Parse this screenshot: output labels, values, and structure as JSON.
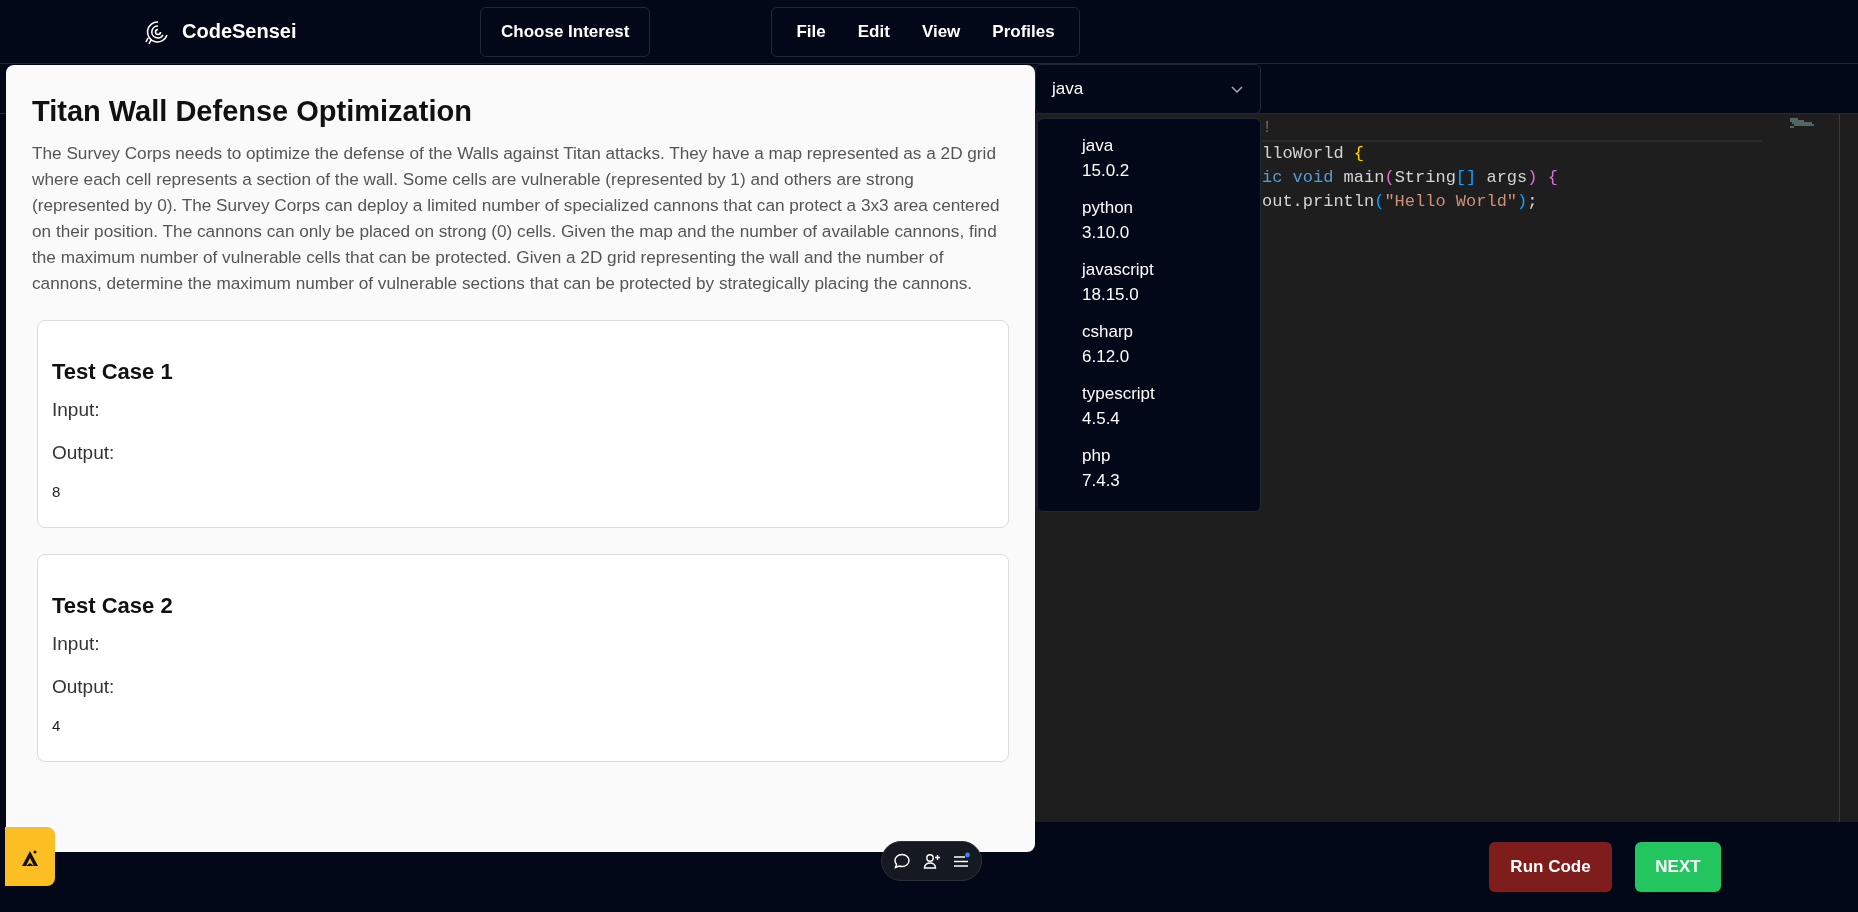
{
  "header": {
    "brand": "CodeSensei",
    "interest_button": "Choose Interest",
    "menu": [
      "File",
      "Edit",
      "View",
      "Profiles"
    ]
  },
  "problem": {
    "title": "Titan Wall Defense Optimization",
    "description": "The Survey Corps needs to optimize the defense of the Walls against Titan attacks. They have a map represented as a 2D grid where each cell represents a section of the wall. Some cells are vulnerable (represented by 1) and others are strong (represented by 0). The Survey Corps can deploy a limited number of specialized cannons that can protect a 3x3 area centered on their position. The cannons can only be placed on strong (0) cells. Given the map and the number of available cannons, find the maximum number of vulnerable cells that can be protected. Given a 2D grid representing the wall and the number of cannons, determine the maximum number of vulnerable sections that can be protected by strategically placing the cannons.",
    "test_cases": [
      {
        "title": "Test Case 1",
        "input_label": "Input:",
        "output_label": "Output:",
        "output": "8"
      },
      {
        "title": "Test Case 2",
        "input_label": "Input:",
        "output_label": "Output:",
        "output": "4"
      }
    ]
  },
  "editor": {
    "language_select": "java",
    "language_menu": [
      {
        "name": "java",
        "version": "15.0.2"
      },
      {
        "name": "python",
        "version": "3.10.0"
      },
      {
        "name": "javascript",
        "version": "18.15.0"
      },
      {
        "name": "csharp",
        "version": "6.12.0"
      },
      {
        "name": "typescript",
        "version": "4.5.4"
      },
      {
        "name": "php",
        "version": "7.4.3"
      }
    ],
    "code_lines": [
      [
        {
          "text": "!",
          "kind": "comment"
        }
      ],
      [
        {
          "text": "lloWorld ",
          "kind": "plain"
        },
        {
          "text": "{",
          "kind": "bracket1"
        }
      ],
      [
        {
          "text": "ic",
          "kind": "keyword"
        },
        {
          "text": " void",
          "kind": "keyword"
        },
        {
          "text": " main",
          "kind": "plain"
        },
        {
          "text": "(",
          "kind": "bracket2"
        },
        {
          "text": "String",
          "kind": "plain"
        },
        {
          "text": "[]",
          "kind": "bracket3"
        },
        {
          "text": " args",
          "kind": "plain"
        },
        {
          "text": ")",
          "kind": "bracket2"
        },
        {
          "text": " {",
          "kind": "bracket2"
        }
      ],
      [
        {
          "text": "out.println",
          "kind": "plain"
        },
        {
          "text": "(",
          "kind": "bracket3"
        },
        {
          "text": "\"Hello World\"",
          "kind": "string"
        },
        {
          "text": ")",
          "kind": "bracket3"
        },
        {
          "text": ";",
          "kind": "plain"
        }
      ]
    ]
  },
  "actions": {
    "run": "Run Code",
    "next": "NEXT"
  }
}
